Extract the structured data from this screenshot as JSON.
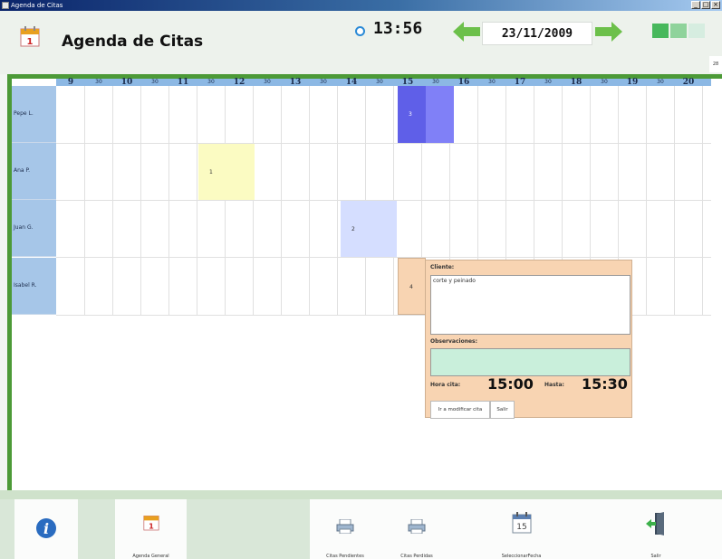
{
  "window": {
    "title": "Agenda de Citas"
  },
  "header": {
    "title": "Agenda de Citas",
    "time": "13:56",
    "date": "23/11/2009",
    "side_tag": "28",
    "colors": {
      "accent_green": "#4c9a37",
      "arrow_green": "#6cc04a"
    }
  },
  "schedule": {
    "ticks": [
      "9",
      "30",
      "10",
      "30",
      "11",
      "30",
      "12",
      "30",
      "13",
      "30",
      "14",
      "30",
      "15",
      "30",
      "16",
      "30",
      "17",
      "30",
      "18",
      "30",
      "19",
      "30",
      "20"
    ],
    "people": [
      "Pepe L.",
      "Ana P.",
      "Juan G.",
      "Isabel R."
    ],
    "appointments": [
      {
        "number": "3",
        "person": "Pepe L.",
        "start": "15:00",
        "end": "16:00",
        "color": "#7b7bf5"
      },
      {
        "number": "1",
        "person": "Ana P.",
        "start": "11:30",
        "end": "12:30",
        "color": "#fbfbc2"
      },
      {
        "number": "2",
        "person": "Juan G.",
        "start": "14:00",
        "end": "15:00",
        "color": "#d5deff"
      },
      {
        "number": "4",
        "person": "Isabel R.",
        "start": "15:00",
        "end": "15:30",
        "color": "#f8d4b2"
      }
    ]
  },
  "popup": {
    "cliente_label": "Cliente:",
    "cliente_text": "corte y peinado",
    "observaciones_label": "Observaciones:",
    "hora_cita_label": "Hora cita:",
    "hora_cita": "15:00",
    "hasta_label": "Hasta:",
    "hasta": "15:30",
    "modify_button": "Ir a modificar cita",
    "exit_button": "Salir"
  },
  "toolbar": {
    "info_icon": "info-icon",
    "agenda_general": "Agenda General",
    "citas_pendientes": "Citas Pendientes",
    "citas_perdidas": "Citas Perdidas",
    "seleccionar_fecha": "SeleccionarFecha",
    "salir": "Salir",
    "calendar_day": "15"
  }
}
